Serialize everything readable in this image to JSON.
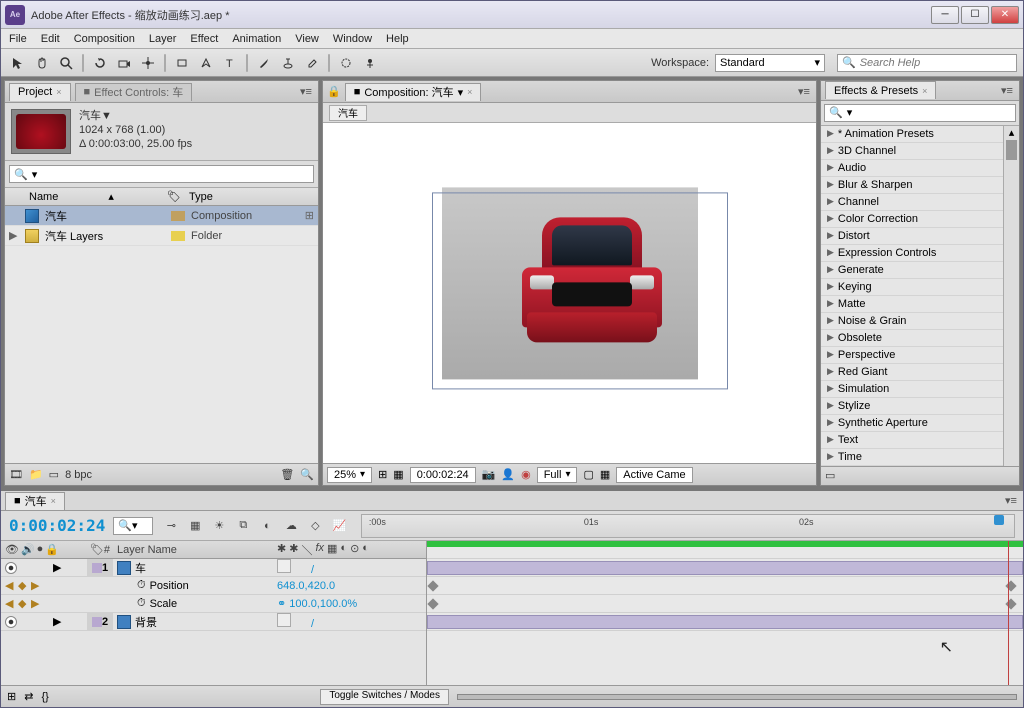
{
  "title": "Adobe After Effects - 缩放动画练习.aep *",
  "menu": [
    "File",
    "Edit",
    "Composition",
    "Layer",
    "Effect",
    "Animation",
    "View",
    "Window",
    "Help"
  ],
  "workspace": {
    "label": "Workspace:",
    "value": "Standard"
  },
  "search_help": "Search Help",
  "project": {
    "tab": "Project",
    "tab2": "Effect Controls: 车",
    "asset_name": "汽车▼",
    "dims": "1024 x 768 (1.00)",
    "dur": "Δ 0:00:03:00, 25.00 fps",
    "cols": {
      "name": "Name",
      "type": "Type"
    },
    "rows": [
      {
        "name": "汽车",
        "type": "Composition",
        "icon": "comp",
        "sel": true,
        "tw": ""
      },
      {
        "name": "汽车 Layers",
        "type": "Folder",
        "icon": "folder",
        "sel": false,
        "tw": "▶"
      }
    ],
    "bpc": "8 bpc"
  },
  "comp": {
    "tab_label": "Composition: 汽车",
    "chip": "汽车",
    "zoom": "25%",
    "time": "0:00:02:24",
    "res": "Full",
    "view": "Active Came"
  },
  "effects": {
    "tab": "Effects & Presets",
    "items": [
      "* Animation Presets",
      "3D Channel",
      "Audio",
      "Blur & Sharpen",
      "Channel",
      "Color Correction",
      "Distort",
      "Expression Controls",
      "Generate",
      "Keying",
      "Matte",
      "Noise & Grain",
      "Obsolete",
      "Perspective",
      "Red Giant",
      "Simulation",
      "Stylize",
      "Synthetic Aperture",
      "Text",
      "Time"
    ]
  },
  "timeline": {
    "tab": "汽车",
    "timecode": "0:00:02:24",
    "ruler": [
      ":00s",
      "01s",
      "02s"
    ],
    "col_num": "#",
    "col_layer": "Layer Name",
    "layers": [
      {
        "num": "1",
        "name": "车",
        "props": [
          {
            "name": "Position",
            "value": "648.0,420.0"
          },
          {
            "name": "Scale",
            "value": "100.0,100.0%",
            "link": true
          }
        ]
      },
      {
        "num": "2",
        "name": "背景",
        "props": []
      }
    ],
    "toggle": "Toggle Switches / Modes"
  }
}
